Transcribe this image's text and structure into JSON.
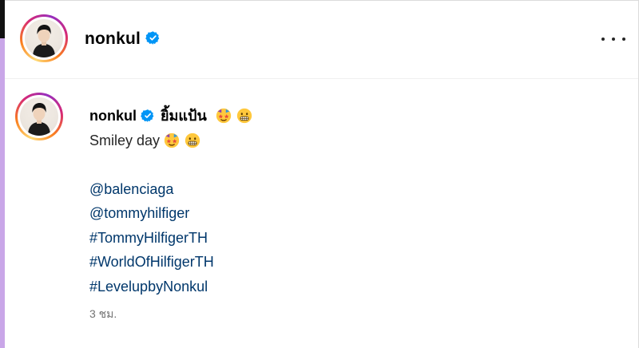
{
  "header": {
    "username": "nonkul",
    "verified_icon": "verified-badge-icon",
    "more_icon": "more-options-icon"
  },
  "post": {
    "username": "nonkul",
    "caption_first_line": "ยิ้มแป้น",
    "caption_lines": [
      "Smiley day"
    ],
    "emojis": [
      "star-struck-face",
      "grimacing-face"
    ],
    "mentions": [
      "@balenciaga",
      "@tommyhilfiger"
    ],
    "hashtags": [
      "#TommyHilfigerTH",
      "#WorldOfHilfigerTH",
      "#LevelupbyNonkul"
    ],
    "timestamp": "3 ชม."
  },
  "colors": {
    "verified": "#0095f6",
    "link": "#00376b",
    "muted": "#737373",
    "sidebar_accent": "#c9a6e8"
  }
}
